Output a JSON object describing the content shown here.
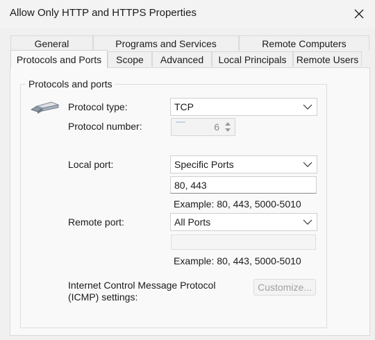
{
  "window": {
    "title": "Allow Only HTTP and HTTPS Properties"
  },
  "tabs": {
    "back_row": [
      "General",
      "Programs and Services",
      "Remote Computers"
    ],
    "front_row": [
      "Protocols and Ports",
      "Scope",
      "Advanced",
      "Local Principals",
      "Remote Users"
    ],
    "active": "Protocols and Ports"
  },
  "group": {
    "title": "Protocols and ports",
    "icon": "network-cable-icon",
    "protocol_type_label": "Protocol type:",
    "protocol_type_value": "TCP",
    "protocol_number_label": "Protocol number:",
    "protocol_number_value": "6",
    "local_port_label": "Local port:",
    "local_port_value": "Specific Ports",
    "local_port_input": "80, 443",
    "local_port_example": "Example: 80, 443, 5000-5010",
    "remote_port_label": "Remote port:",
    "remote_port_value": "All Ports",
    "remote_port_input": "",
    "remote_port_example": "Example: 80, 443, 5000-5010",
    "icmp_label_line1": "Internet Control Message Protocol",
    "icmp_label_line2": "(ICMP) settings:",
    "customize_label": "Customize..."
  }
}
